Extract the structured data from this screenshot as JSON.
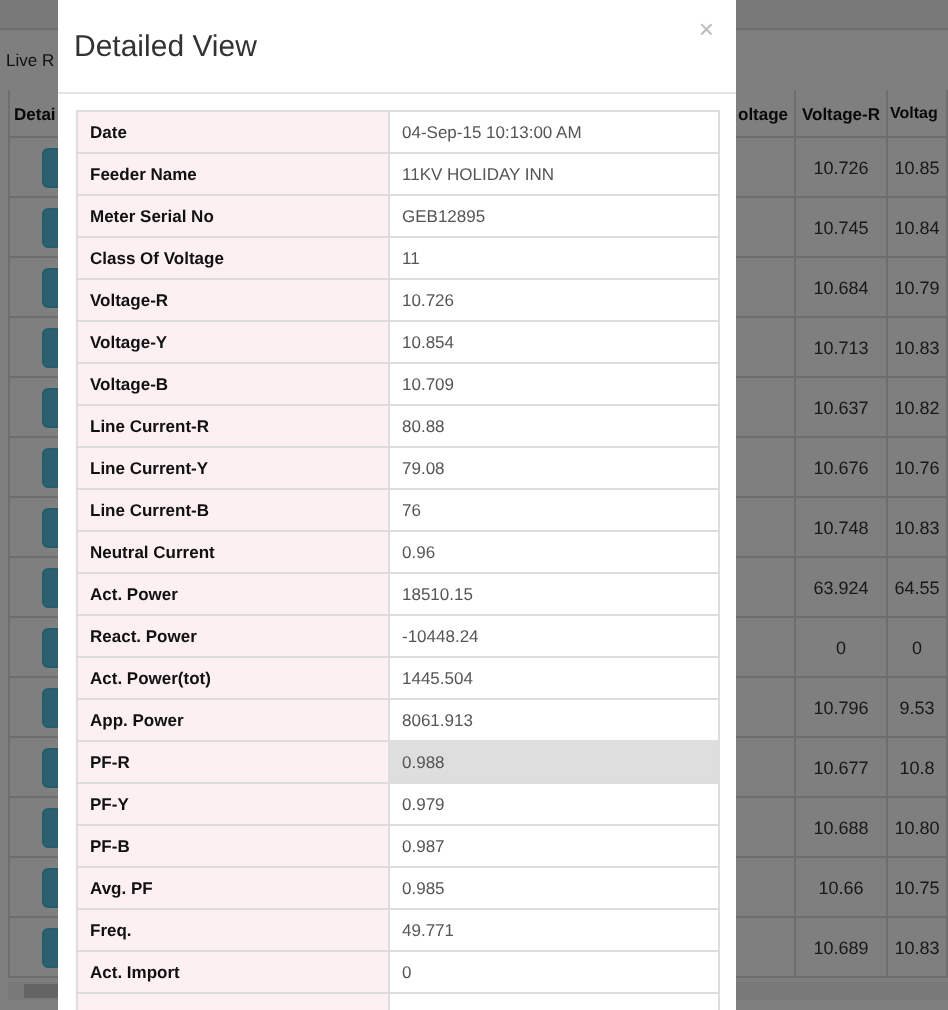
{
  "background": {
    "panel_title": "Live R",
    "table": {
      "columns": [
        "Detai",
        "oltage",
        "Voltage-R",
        "Voltag"
      ],
      "rows": [
        [
          "10.726",
          "10.85"
        ],
        [
          "10.745",
          "10.84"
        ],
        [
          "10.684",
          "10.79"
        ],
        [
          "10.713",
          "10.83"
        ],
        [
          "10.637",
          "10.82"
        ],
        [
          "10.676",
          "10.76"
        ],
        [
          "10.748",
          "10.83"
        ],
        [
          "63.924",
          "64.55"
        ],
        [
          "0",
          "0"
        ],
        [
          "10.796",
          "9.53"
        ],
        [
          "10.677",
          "10.8"
        ],
        [
          "10.688",
          "10.80"
        ],
        [
          "10.66",
          "10.75"
        ],
        [
          "10.689",
          "10.83"
        ]
      ]
    }
  },
  "modal": {
    "title": "Detailed View",
    "close": "×",
    "rows": [
      {
        "label": "Date",
        "value": "04-Sep-15 10:13:00 AM",
        "selected": false
      },
      {
        "label": "Feeder Name",
        "value": "11KV HOLIDAY INN",
        "selected": false
      },
      {
        "label": "Meter Serial No",
        "value": "GEB12895",
        "selected": false
      },
      {
        "label": "Class Of Voltage",
        "value": "11",
        "selected": false
      },
      {
        "label": "Voltage-R",
        "value": "10.726",
        "selected": false
      },
      {
        "label": "Voltage-Y",
        "value": "10.854",
        "selected": false
      },
      {
        "label": "Voltage-B",
        "value": "10.709",
        "selected": false
      },
      {
        "label": "Line Current-R",
        "value": "80.88",
        "selected": false
      },
      {
        "label": "Line Current-Y",
        "value": "79.08",
        "selected": false
      },
      {
        "label": "Line Current-B",
        "value": "76",
        "selected": false
      },
      {
        "label": "Neutral Current",
        "value": "0.96",
        "selected": false
      },
      {
        "label": "Act. Power",
        "value": "18510.15",
        "selected": false
      },
      {
        "label": "React. Power",
        "value": "-10448.24",
        "selected": false
      },
      {
        "label": "Act. Power(tot)",
        "value": "1445.504",
        "selected": false
      },
      {
        "label": "App. Power",
        "value": "8061.913",
        "selected": false
      },
      {
        "label": "PF-R",
        "value": "0.988",
        "selected": true
      },
      {
        "label": "PF-Y",
        "value": "0.979",
        "selected": false
      },
      {
        "label": "PF-B",
        "value": "0.987",
        "selected": false
      },
      {
        "label": "Avg. PF",
        "value": "0.985",
        "selected": false
      },
      {
        "label": "Freq.",
        "value": "49.771",
        "selected": false
      },
      {
        "label": "Act. Import",
        "value": "0",
        "selected": false
      }
    ]
  }
}
